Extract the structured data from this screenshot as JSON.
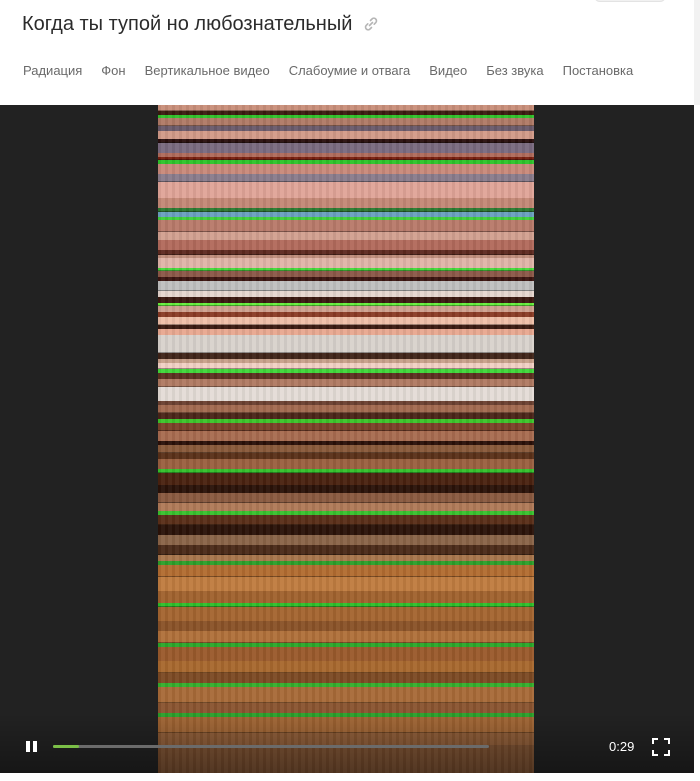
{
  "post": {
    "title": "Когда ты тупой но любознательный",
    "link_icon": "link-icon"
  },
  "tags": [
    "Радиация",
    "Фон",
    "Вертикальное видео",
    "Слабоумие и отвага",
    "Видео",
    "Без звука",
    "Постановка"
  ],
  "player": {
    "duration_label": "0:29",
    "progress_fraction": 0.06,
    "state": "playing",
    "pause_icon": "pause-icon",
    "fullscreen_icon": "fullscreen-icon",
    "accent_color": "#7bbf47"
  }
}
